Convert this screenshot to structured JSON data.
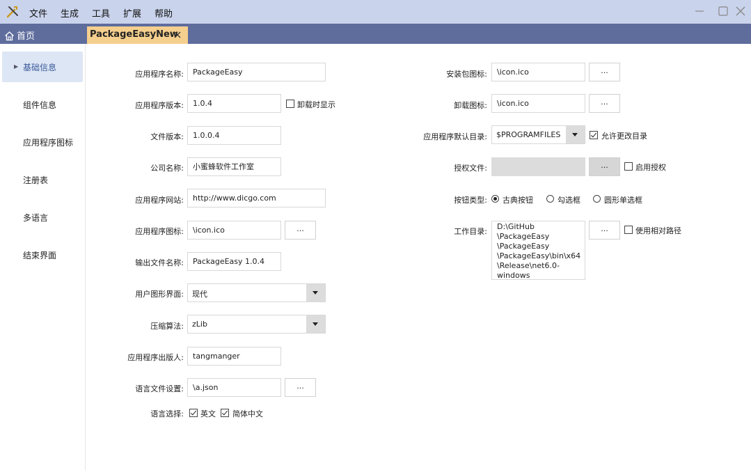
{
  "menu": [
    "文件",
    "生成",
    "工具",
    "扩展",
    "帮助"
  ],
  "tabs": {
    "home": "首页",
    "document": "PackageEasyNew"
  },
  "sidebar": {
    "items": [
      "基础信息",
      "组件信息",
      "应用程序图标",
      "注册表",
      "多语言",
      "结束界面"
    ],
    "active_index": 0
  },
  "left_form": {
    "app_name": {
      "label": "应用程序名称:",
      "value": "PackageEasy"
    },
    "app_version": {
      "label": "应用程序版本:",
      "value": "1.0.4",
      "checkbox_label": "卸载时显示",
      "checked": false
    },
    "file_version": {
      "label": "文件版本:",
      "value": "1.0.0.4"
    },
    "company": {
      "label": "公司名称:",
      "value": "小蜜蜂软件工作室"
    },
    "website": {
      "label": "应用程序网站:",
      "value": "http://www.dicgo.com"
    },
    "app_icon": {
      "label": "应用程序图标:",
      "value": "\\icon.ico",
      "browse": "..."
    },
    "output_name": {
      "label": "输出文件名称:",
      "value": "PackageEasy 1.0.4"
    },
    "gui": {
      "label": "用户图形界面:",
      "value": "现代"
    },
    "compression": {
      "label": "压缩算法:",
      "value": "zLib"
    },
    "publisher": {
      "label": "应用程序出版人:",
      "value": "tangmanger"
    },
    "lang_file": {
      "label": "语言文件设置:",
      "value": "\\a.json",
      "browse": "..."
    },
    "lang_select": {
      "label": "语言选择:",
      "options": [
        "英文",
        "简体中文"
      ],
      "checked": [
        true,
        true
      ]
    }
  },
  "right_form": {
    "install_icon": {
      "label": "安装包图标:",
      "value": "\\icon.ico",
      "browse": "..."
    },
    "uninstall_icon": {
      "label": "卸载图标:",
      "value": "\\icon.ico",
      "browse": "..."
    },
    "default_dir": {
      "label": "应用程序默认目录:",
      "value": "$PROGRAMFILES",
      "checkbox_label": "允许更改目录",
      "checked": true
    },
    "license_file": {
      "label": "授权文件:",
      "value": "",
      "browse": "...",
      "checkbox_label": "启用授权",
      "checked": false
    },
    "button_type": {
      "label": "按钮类型:",
      "options": [
        "古典按钮",
        "勾选框",
        "圆形单选框"
      ],
      "selected": 0
    },
    "work_dir": {
      "label": "工作目录:",
      "value": "D:\\GitHub\n\\PackageEasy\n\\PackageEasy\n\\PackageEasy\\bin\\x64\n\\Release\\net6.0-\nwindows",
      "browse": "...",
      "checkbox_label": "使用相对路径",
      "checked": false
    }
  },
  "colors": {
    "titlebar": "#c9d3ec",
    "tabbar": "#5f6d9d",
    "active_tab": "#f5cf8e",
    "sidebar_active": "#dde6f4"
  }
}
